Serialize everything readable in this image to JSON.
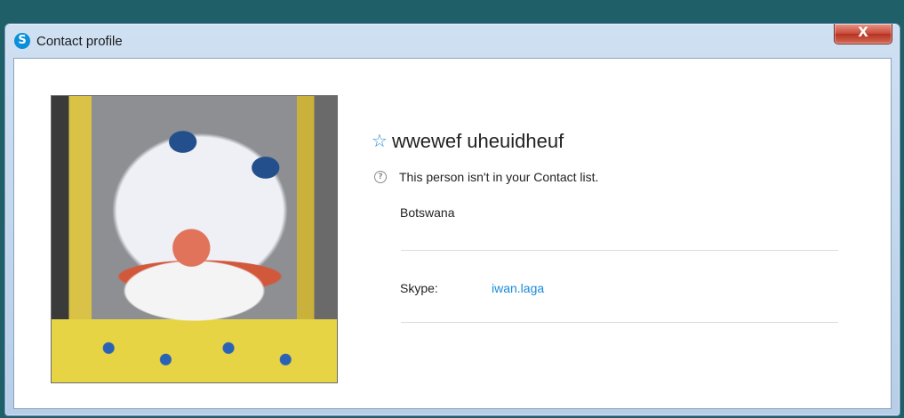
{
  "window": {
    "title": "Contact profile",
    "close_label": "X"
  },
  "icons": {
    "app": "skype-logo-icon",
    "favorite": "star-outline-icon",
    "help": "question-circle-icon",
    "app_glyph": "S",
    "star_glyph": "☆",
    "help_glyph": "?"
  },
  "colors": {
    "accent": "#1a8ad8",
    "close_button": "#c8493a",
    "desktop": "#1f5f68"
  },
  "profile": {
    "name": "wwewef uheuidheuf",
    "status_text": "This person isn't in your Contact list.",
    "location": "Botswana",
    "skype_label": "Skype:",
    "skype_id": "iwan.laga"
  }
}
